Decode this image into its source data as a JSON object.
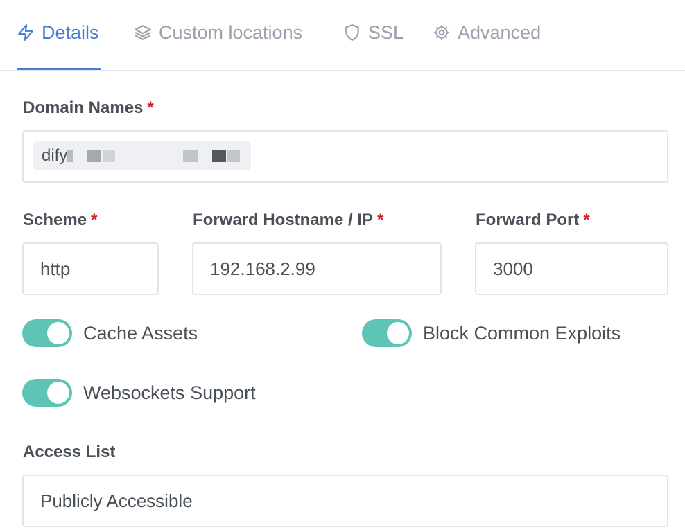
{
  "tabs": [
    {
      "label": "Details",
      "icon": "lightning-icon",
      "active": true
    },
    {
      "label": "Custom locations",
      "icon": "layers-icon",
      "active": false
    },
    {
      "label": "SSL",
      "icon": "shield-icon",
      "active": false
    },
    {
      "label": "Advanced",
      "icon": "gear-icon",
      "active": false
    }
  ],
  "form": {
    "domain_names": {
      "label": "Domain Names",
      "required": "*",
      "chip_value": "dify"
    },
    "scheme": {
      "label": "Scheme",
      "required": "*",
      "value": "http"
    },
    "forward_host": {
      "label": "Forward Hostname / IP",
      "required": "*",
      "value": "192.168.2.99"
    },
    "forward_port": {
      "label": "Forward Port",
      "required": "*",
      "value": "3000"
    },
    "toggles": {
      "cache_assets": {
        "label": "Cache Assets",
        "on": true
      },
      "block_exploits": {
        "label": "Block Common Exploits",
        "on": true
      },
      "websockets": {
        "label": "Websockets Support",
        "on": true
      }
    },
    "access_list": {
      "label": "Access List",
      "value": "Publicly Accessible"
    }
  },
  "colors": {
    "accent": "#467fcf",
    "toggle_on": "#5ec4b6",
    "required": "#cd201f"
  }
}
